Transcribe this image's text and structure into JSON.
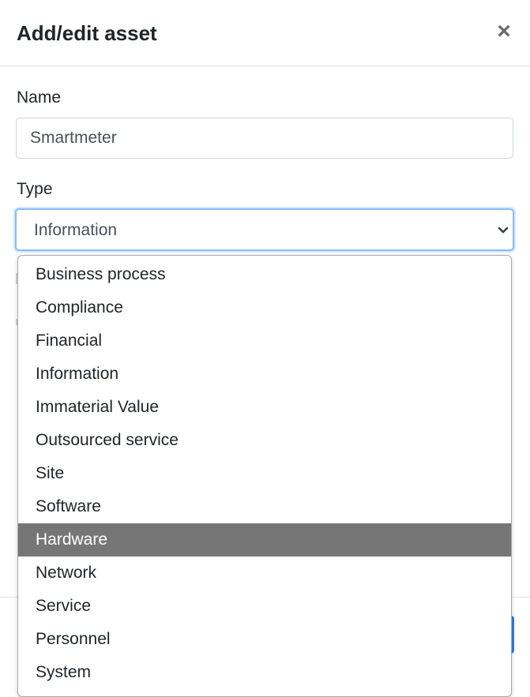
{
  "modal": {
    "title": "Add/edit asset",
    "close_label": "×"
  },
  "form": {
    "name_label": "Name",
    "name_value": "Smartmeter",
    "type_label": "Type",
    "type_value": "Information"
  },
  "dropdown": {
    "options": [
      "Business process",
      "Compliance",
      "Financial",
      "Information",
      "Immaterial Value",
      "Outsourced service",
      "Site",
      "Software",
      "Hardware",
      "Network",
      "Service",
      "Personnel",
      "System"
    ],
    "highlighted": "Hardware"
  },
  "colors": {
    "highlight": "#767676",
    "focus_border": "#8bbcf2",
    "primary": "#2b7de9"
  }
}
